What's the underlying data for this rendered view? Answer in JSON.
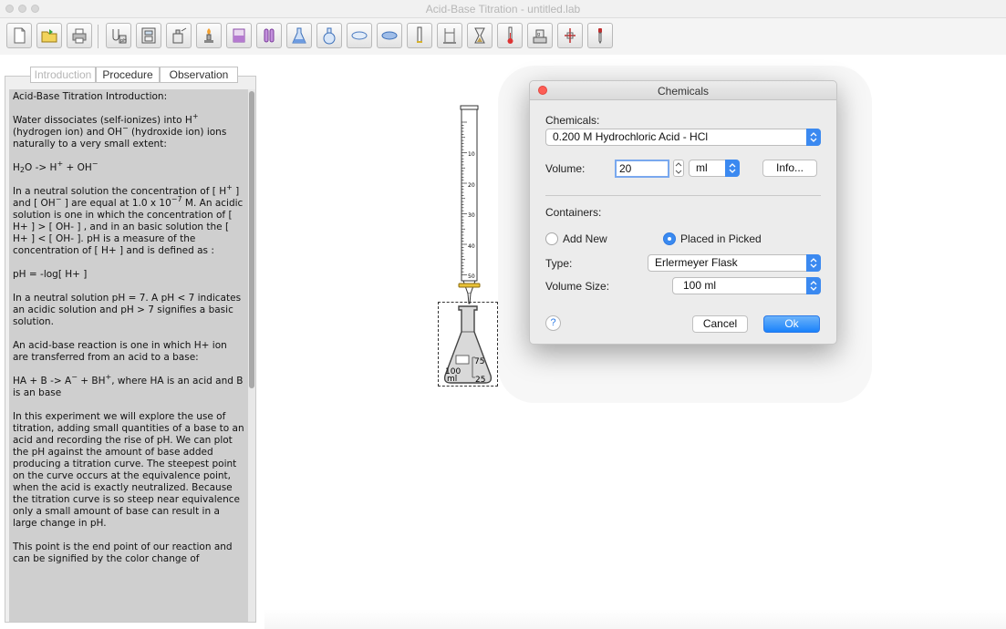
{
  "window": {
    "title": "Acid-Base Titration - untitled.lab"
  },
  "toolbar": {
    "tools": [
      "new-icon",
      "open-icon",
      "print-icon",
      "ph-meter-icon",
      "calculator-icon",
      "reagent-bottle-icon",
      "bunsen-burner-icon",
      "beaker-icon",
      "test-tubes-icon",
      "conical-flask-icon",
      "round-flask-icon",
      "petri-dish-icon",
      "evaporating-dish-icon",
      "burette-icon",
      "burette-stand-icon",
      "hourglass-icon",
      "thermometer-icon",
      "balance-icon",
      "clamp-icon",
      "dropper-icon"
    ]
  },
  "tabs": [
    {
      "label": "Introduction",
      "active": true
    },
    {
      "label": "Procedure",
      "active": false
    },
    {
      "label": "Observation",
      "active": false
    }
  ],
  "intro": {
    "heading": "Acid-Base Titration Introduction:",
    "p1a": "Water dissociates (self-ionizes) into H",
    "p1sup1": "+",
    "p1b": "(hydrogen ion)  and OH",
    "p1sup2": "−",
    "p1c": "  (hydroxide ion) ions naturally to a  very small extent:",
    "eq1a": "H",
    "eq1sub": "2",
    "eq1b": "O  -> H",
    "eq1sup1": "+",
    "eq1c": "  +   OH",
    "eq1sup2": "−",
    "p2a": "In a neutral solution  the concentration of [ H",
    "p2sup1": "+",
    "p2b": " ] and [ OH",
    "p2sup2": "−",
    "p2c": " ]  are equal at 1.0 x 10",
    "p2sup3": "−7",
    "p2d": " M. An acidic solution is one in which the concentration of  [ H+ ] >  [ OH- ] , and in an basic solution the [ H+ ]  <  [ OH- ].  pH is a measure of the concentration of [ H+ ] and is defined as :",
    "eq2": "pH = -log[ H+  ]",
    "p3": "In a neutral solution pH = 7.  A  pH < 7 indicates an acidic solution and pH > 7 signifies a basic solution.",
    "p4": "An acid-base reaction is one in which  H+ ion are transferred from an acid to a base:",
    "eq3a": "HA  + B ->  A",
    "eq3sup1": "−",
    "eq3b": "  + BH",
    "eq3sup2": "+",
    "eq3c": ",   where HA is an acid and B is an base",
    "p5": "In this experiment we will explore the use of titration, adding small quantities of a base to an acid and recording the rise of  pH. We can plot the pH against the amount of base added producing a titration curve. The steepest point on the curve occurs at the equivalence point, when the acid is exactly neutralized. Because the titration curve is so steep near equivalence only a small amount of  base can result in a large change in pH.",
    "p6": "This point is the end point of our reaction and can be signified by the color change of"
  },
  "burette": {
    "ticks": [
      "10",
      "20",
      "30",
      "40",
      "50"
    ]
  },
  "flask": {
    "marks": [
      "75",
      "25"
    ],
    "capacity": "100\nml"
  },
  "dialog": {
    "title": "Chemicals",
    "chemicals_label": "Chemicals:",
    "chemical_selected": "0.200 M Hydrochloric Acid  -  HCl",
    "volume_label": "Volume:",
    "volume_value": "20",
    "unit_selected": "ml",
    "info_label": "Info...",
    "containers_label": "Containers:",
    "add_new_label": "Add New",
    "placed_label": "Placed in Picked",
    "type_label": "Type:",
    "type_selected": "Erlermeyer Flask",
    "volume_size_label": "Volume Size:",
    "volume_size_selected": "100 ml",
    "help_label": "?",
    "cancel_label": "Cancel",
    "ok_label": "Ok"
  }
}
